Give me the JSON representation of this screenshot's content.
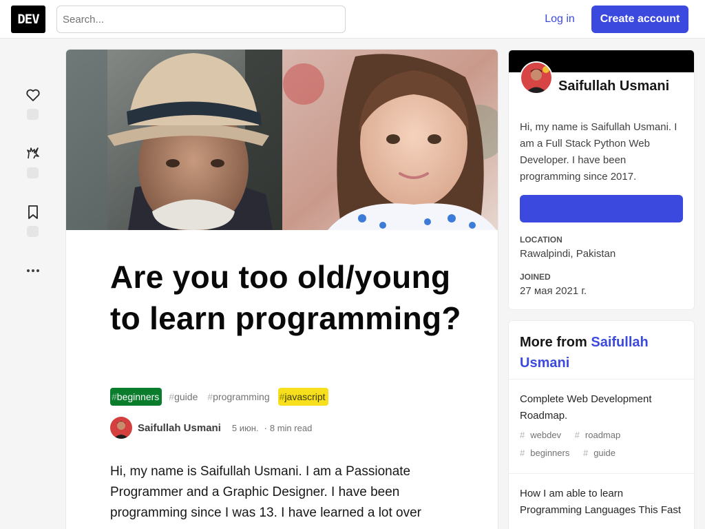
{
  "header": {
    "logo": "DEV",
    "search_placeholder": "Search...",
    "login_label": "Log in",
    "create_account_label": "Create account"
  },
  "reactions": {
    "icons": [
      "heart-icon",
      "unicorn-icon",
      "bookmark-icon",
      "more-icon"
    ]
  },
  "article": {
    "title": "Are you too old/young to learn programming?",
    "tags": [
      {
        "name": "beginners",
        "bg": "#0a7d2c",
        "fg": "#ffffff"
      },
      {
        "name": "guide",
        "bg": "",
        "fg": "#737373"
      },
      {
        "name": "programming",
        "bg": "",
        "fg": "#737373"
      },
      {
        "name": "javascript",
        "bg": "#f7df1e",
        "fg": "#3b3b00"
      }
    ],
    "author": "Saifullah Usmani",
    "date": "5 июн.",
    "read_time": "8 min read",
    "body": "Hi, my name is Saifullah Usmani. I am a Passionate Programmer and a Graphic Designer. I have been programming since I was 13. I have learned a lot over"
  },
  "sidebar": {
    "name": "Saifullah Usmani",
    "bio": "Hi, my name is Saifullah Usmani. I am a Full Stack Python Web Developer. I have been programming since 2017.",
    "location_label": "LOCATION",
    "location": "Rawalpindi, Pakistan",
    "joined_label": "JOINED",
    "joined": "27 мая 2021 г.",
    "more_from_prefix": "More from",
    "more_from_author": "Saifullah Usmani",
    "more_items": [
      {
        "title": "Complete Web Development Roadmap.",
        "tags": [
          "webdev",
          "roadmap",
          "beginners",
          "guide"
        ]
      },
      {
        "title": "How I am able to learn Programming Languages This Fast",
        "tags": []
      }
    ]
  },
  "colors": {
    "accent": "#3b49df",
    "background": "#f5f5f5"
  }
}
